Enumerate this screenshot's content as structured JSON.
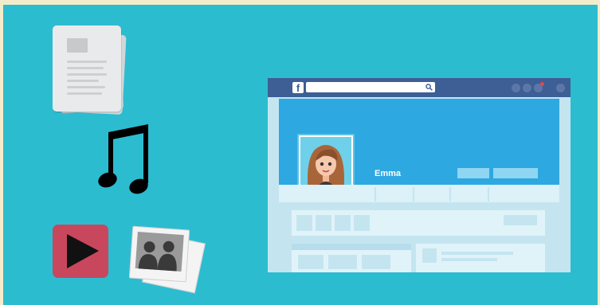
{
  "profile": {
    "name": "Emma",
    "network_logo": "f"
  },
  "icons": {
    "document": "document-stack-icon",
    "music": "music-note-icon",
    "video": "play-video-icon",
    "photo": "photo-stack-icon",
    "search": "search-icon",
    "notification": "notification-icon"
  },
  "colors": {
    "background": "#2cbcd0",
    "navbar": "#3d5f95",
    "cover": "#2ea8e0",
    "play_button": "#c8475d",
    "notification_dot": "#e8434e"
  }
}
